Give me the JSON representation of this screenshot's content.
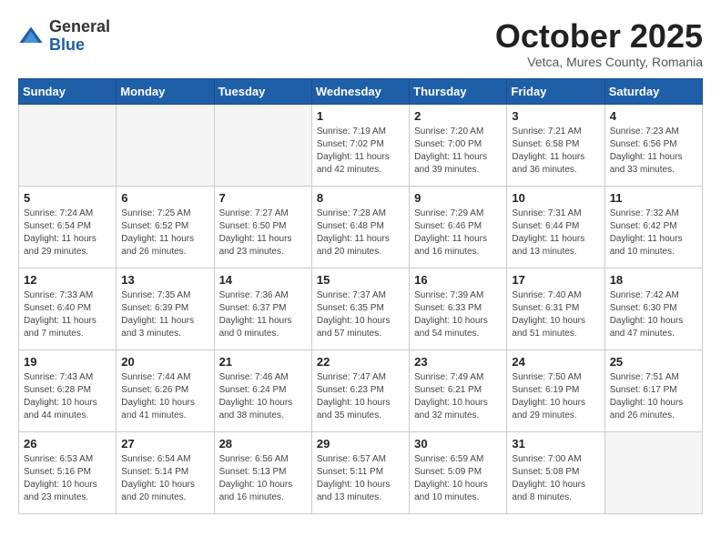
{
  "header": {
    "logo_general": "General",
    "logo_blue": "Blue",
    "month_title": "October 2025",
    "location": "Vetca, Mures County, Romania"
  },
  "weekdays": [
    "Sunday",
    "Monday",
    "Tuesday",
    "Wednesday",
    "Thursday",
    "Friday",
    "Saturday"
  ],
  "weeks": [
    [
      {
        "day": "",
        "info": ""
      },
      {
        "day": "",
        "info": ""
      },
      {
        "day": "",
        "info": ""
      },
      {
        "day": "1",
        "info": "Sunrise: 7:19 AM\nSunset: 7:02 PM\nDaylight: 11 hours\nand 42 minutes."
      },
      {
        "day": "2",
        "info": "Sunrise: 7:20 AM\nSunset: 7:00 PM\nDaylight: 11 hours\nand 39 minutes."
      },
      {
        "day": "3",
        "info": "Sunrise: 7:21 AM\nSunset: 6:58 PM\nDaylight: 11 hours\nand 36 minutes."
      },
      {
        "day": "4",
        "info": "Sunrise: 7:23 AM\nSunset: 6:56 PM\nDaylight: 11 hours\nand 33 minutes."
      }
    ],
    [
      {
        "day": "5",
        "info": "Sunrise: 7:24 AM\nSunset: 6:54 PM\nDaylight: 11 hours\nand 29 minutes."
      },
      {
        "day": "6",
        "info": "Sunrise: 7:25 AM\nSunset: 6:52 PM\nDaylight: 11 hours\nand 26 minutes."
      },
      {
        "day": "7",
        "info": "Sunrise: 7:27 AM\nSunset: 6:50 PM\nDaylight: 11 hours\nand 23 minutes."
      },
      {
        "day": "8",
        "info": "Sunrise: 7:28 AM\nSunset: 6:48 PM\nDaylight: 11 hours\nand 20 minutes."
      },
      {
        "day": "9",
        "info": "Sunrise: 7:29 AM\nSunset: 6:46 PM\nDaylight: 11 hours\nand 16 minutes."
      },
      {
        "day": "10",
        "info": "Sunrise: 7:31 AM\nSunset: 6:44 PM\nDaylight: 11 hours\nand 13 minutes."
      },
      {
        "day": "11",
        "info": "Sunrise: 7:32 AM\nSunset: 6:42 PM\nDaylight: 11 hours\nand 10 minutes."
      }
    ],
    [
      {
        "day": "12",
        "info": "Sunrise: 7:33 AM\nSunset: 6:40 PM\nDaylight: 11 hours\nand 7 minutes."
      },
      {
        "day": "13",
        "info": "Sunrise: 7:35 AM\nSunset: 6:39 PM\nDaylight: 11 hours\nand 3 minutes."
      },
      {
        "day": "14",
        "info": "Sunrise: 7:36 AM\nSunset: 6:37 PM\nDaylight: 11 hours\nand 0 minutes."
      },
      {
        "day": "15",
        "info": "Sunrise: 7:37 AM\nSunset: 6:35 PM\nDaylight: 10 hours\nand 57 minutes."
      },
      {
        "day": "16",
        "info": "Sunrise: 7:39 AM\nSunset: 6:33 PM\nDaylight: 10 hours\nand 54 minutes."
      },
      {
        "day": "17",
        "info": "Sunrise: 7:40 AM\nSunset: 6:31 PM\nDaylight: 10 hours\nand 51 minutes."
      },
      {
        "day": "18",
        "info": "Sunrise: 7:42 AM\nSunset: 6:30 PM\nDaylight: 10 hours\nand 47 minutes."
      }
    ],
    [
      {
        "day": "19",
        "info": "Sunrise: 7:43 AM\nSunset: 6:28 PM\nDaylight: 10 hours\nand 44 minutes."
      },
      {
        "day": "20",
        "info": "Sunrise: 7:44 AM\nSunset: 6:26 PM\nDaylight: 10 hours\nand 41 minutes."
      },
      {
        "day": "21",
        "info": "Sunrise: 7:46 AM\nSunset: 6:24 PM\nDaylight: 10 hours\nand 38 minutes."
      },
      {
        "day": "22",
        "info": "Sunrise: 7:47 AM\nSunset: 6:23 PM\nDaylight: 10 hours\nand 35 minutes."
      },
      {
        "day": "23",
        "info": "Sunrise: 7:49 AM\nSunset: 6:21 PM\nDaylight: 10 hours\nand 32 minutes."
      },
      {
        "day": "24",
        "info": "Sunrise: 7:50 AM\nSunset: 6:19 PM\nDaylight: 10 hours\nand 29 minutes."
      },
      {
        "day": "25",
        "info": "Sunrise: 7:51 AM\nSunset: 6:17 PM\nDaylight: 10 hours\nand 26 minutes."
      }
    ],
    [
      {
        "day": "26",
        "info": "Sunrise: 6:53 AM\nSunset: 5:16 PM\nDaylight: 10 hours\nand 23 minutes."
      },
      {
        "day": "27",
        "info": "Sunrise: 6:54 AM\nSunset: 5:14 PM\nDaylight: 10 hours\nand 20 minutes."
      },
      {
        "day": "28",
        "info": "Sunrise: 6:56 AM\nSunset: 5:13 PM\nDaylight: 10 hours\nand 16 minutes."
      },
      {
        "day": "29",
        "info": "Sunrise: 6:57 AM\nSunset: 5:11 PM\nDaylight: 10 hours\nand 13 minutes."
      },
      {
        "day": "30",
        "info": "Sunrise: 6:59 AM\nSunset: 5:09 PM\nDaylight: 10 hours\nand 10 minutes."
      },
      {
        "day": "31",
        "info": "Sunrise: 7:00 AM\nSunset: 5:08 PM\nDaylight: 10 hours\nand 8 minutes."
      },
      {
        "day": "",
        "info": ""
      }
    ]
  ]
}
